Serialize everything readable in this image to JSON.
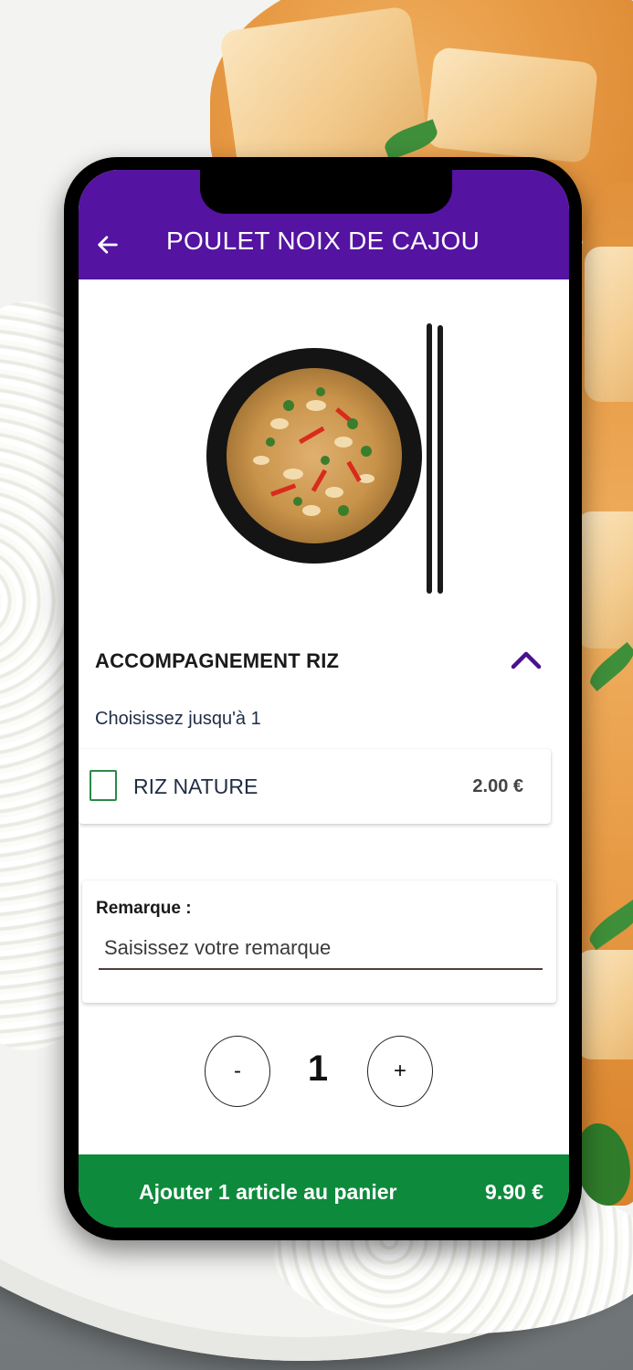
{
  "header": {
    "title": "POULET NOIX DE CAJOU",
    "back_icon": "arrow-left-icon"
  },
  "product": {
    "image_icon": "dish-with-chopsticks"
  },
  "options_section": {
    "title": "ACCOMPAGNEMENT RIZ",
    "collapse_icon": "chevron-up-icon",
    "hint": "Choisissez jusqu'à 1",
    "items": [
      {
        "label": "RIZ NATURE",
        "price": "2.00 €",
        "checked": false
      }
    ]
  },
  "remark": {
    "label": "Remarque :",
    "placeholder": "Saisissez votre remarque",
    "value": ""
  },
  "quantity": {
    "minus_label": "-",
    "value": "1",
    "plus_label": "+"
  },
  "add_to_cart": {
    "label": "Ajouter 1 article au panier",
    "price": "9.90 €"
  },
  "colors": {
    "header_bg": "#5413a0",
    "accent_purple": "#5413a0",
    "cart_button_bg": "#0e8a3c",
    "checkbox_border": "#2a8a4a"
  }
}
